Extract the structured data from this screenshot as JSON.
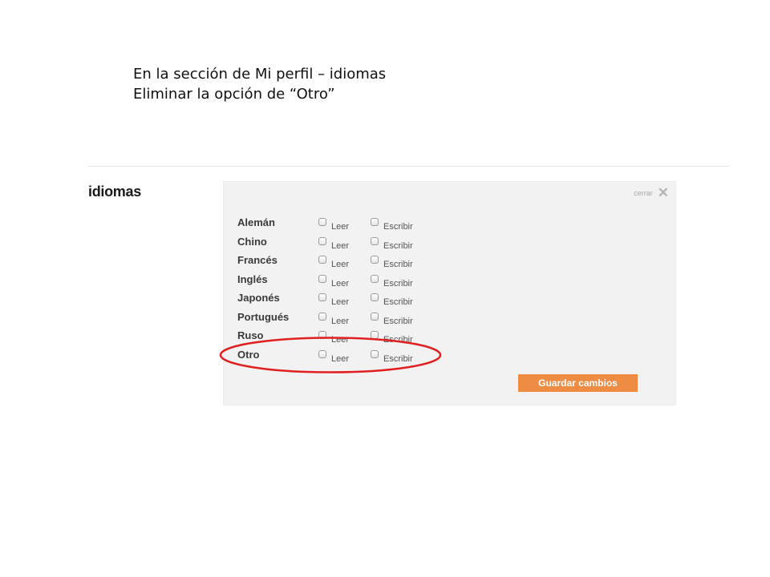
{
  "note": {
    "line1": "En la sección de Mi perfil – idiomas",
    "line2": "Eliminar la opción de “Otro”"
  },
  "section": {
    "title": "idiomas"
  },
  "panel": {
    "close_label": "cerrar",
    "close_icon": "✕",
    "read_label": "Leer",
    "write_label": "Escribir",
    "languages": [
      "Alemán",
      "Chino",
      "Francés",
      "Inglés",
      "Japonés",
      "Portugués",
      "Ruso",
      "Otro"
    ],
    "save_label": "Guardar cambios"
  },
  "colors": {
    "accent": "#ef8c43",
    "panel_bg": "#f2f2f2",
    "annotation": "#e02020"
  }
}
